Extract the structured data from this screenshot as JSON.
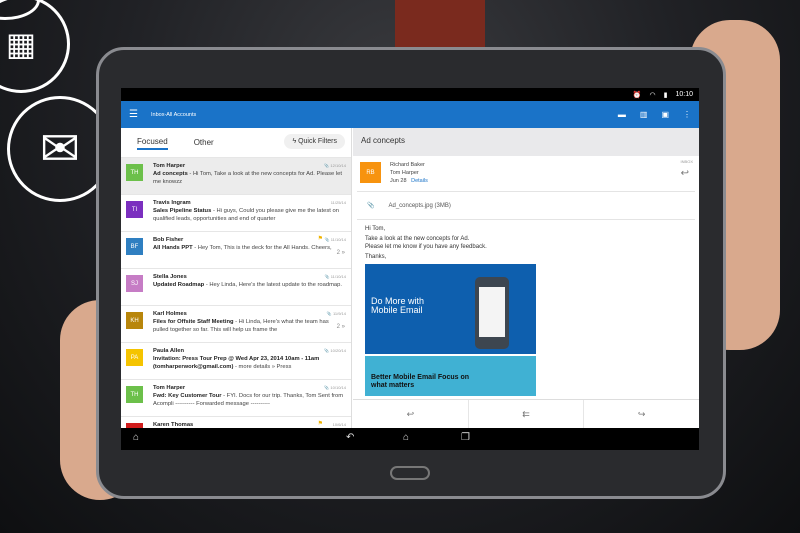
{
  "status": {
    "time": "10:10"
  },
  "appbar": {
    "title": "Inbox-All Accounts"
  },
  "tabs": {
    "focused": "Focused",
    "other": "Other",
    "quick_filters": "Quick Filters"
  },
  "messages": [
    {
      "initials": "TH",
      "color": "#6cc04a",
      "from": "Tom Harper",
      "subject": "Ad concepts",
      "preview": " - Hi Tom, Take a look at the new concepts for Ad. Please let me knowzz",
      "date": "12/10/14",
      "attachment": true,
      "selected": true
    },
    {
      "initials": "TI",
      "color": "#7b2fbf",
      "from": "Travis Ingram",
      "subject": "Sales Pipeline Status",
      "preview": " - Hi guys, Could you please give me the latest on qualified leads, opportunities and end of quarter",
      "date": "11/25/14"
    },
    {
      "initials": "BF",
      "color": "#2f7fc1",
      "from": "Bob Fisher",
      "subject": "All Hands PPT",
      "preview": " - Hey Tom, This is the deck for the All Hands. Cheers,",
      "date": "11/10/14",
      "attachment": true,
      "flag": true,
      "count": "2"
    },
    {
      "initials": "SJ",
      "color": "#c67cc5",
      "from": "Stella Jones",
      "subject": "Updated Roadmap",
      "preview": " - Hey Linda, Here's the latest update to the roadmap.",
      "date": "11/10/14",
      "attachment": true
    },
    {
      "initials": "KH",
      "color": "#b8860b",
      "from": "Karl Holmes",
      "subject": "Files for Offsite Staff Meeting",
      "preview": " - Hi Linda, Here's what the team has pulled together so far. This will help us frame the",
      "date": "11/9/14",
      "attachment": true,
      "count": "2"
    },
    {
      "initials": "PA",
      "color": "#f5c400",
      "from": "Paula Allen",
      "subject": "Invitation: Press Tour Prep @ Wed Apr 23, 2014 10am - 11am (tomharperwork@gmail.com)",
      "preview": " - more details » Press",
      "date": "10/20/14",
      "attachment": true
    },
    {
      "initials": "TH",
      "color": "#6cc04a",
      "from": "Tom Harper",
      "subject": "Fwd: Key Customer Tour",
      "preview": " - FYI. Docs for our trip. Thanks, Tom Sent from Acompli ---------- Forwarded message ----------",
      "date": "10/10/14",
      "attachment": true
    },
    {
      "initials": "KT",
      "color": "#d01c1c",
      "from": "Karen Thomas",
      "subject": "",
      "preview": "",
      "date": "10/6/14",
      "flag": true
    }
  ],
  "reading": {
    "subject": "Ad concepts",
    "initials": "RB",
    "from": "Richard Baker",
    "to": "Tom Harper",
    "date": "Jun 28",
    "details": "Details",
    "folder": "INBOX",
    "attachment": "Ad_concepts.jpg (3MB)",
    "greeting": "Hi Tom,",
    "line1": "Take a look at the new concepts for Ad.",
    "line2": "Please let me know if you have any feedback.",
    "closing": "Thanks,",
    "ad1_text": "Do More with Mobile Email",
    "ad2_text": "Better Mobile Email Focus on what matters"
  },
  "accent": "#1a73c8"
}
